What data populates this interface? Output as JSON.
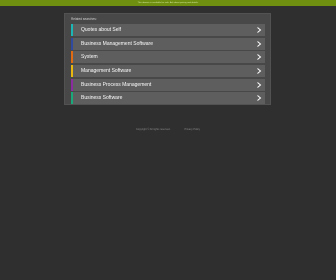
{
  "banner": {
    "text": "This domain is available for sale. Ask about pricing and details.",
    "color": "#6f8f10"
  },
  "panel": {
    "heading": "Related searches:",
    "items": [
      {
        "label": "Quotes about Self",
        "color": "#1db6b6",
        "icon": "chevron-right-icon"
      },
      {
        "label": "Business Management Software",
        "color": "#2f4a9e",
        "icon": "chevron-right-icon"
      },
      {
        "label": "System",
        "color": "#e06b12",
        "icon": "chevron-right-icon"
      },
      {
        "label": "Management Software",
        "color": "#e8b80e",
        "icon": "chevron-right-icon"
      },
      {
        "label": "Business Process Management",
        "color": "#8b2ca0",
        "icon": "chevron-right-icon"
      },
      {
        "label": "Business Software",
        "color": "#1aa87a",
        "icon": "chevron-right-icon"
      }
    ]
  },
  "footer": {
    "copyright": "Copyright © All rights reserved.",
    "privacy": "Privacy Policy"
  },
  "colors": {
    "page_background": "#2f2f2f",
    "panel_background": "#484848",
    "item_background": "#5e5e5e"
  }
}
